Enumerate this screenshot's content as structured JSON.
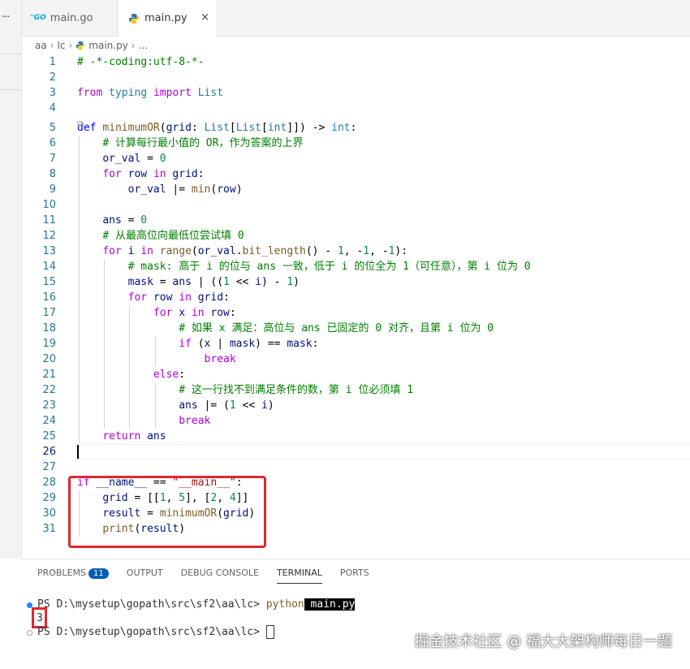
{
  "tabs": [
    {
      "label": "main.go",
      "icon": "go-file-icon"
    },
    {
      "label": "main.py",
      "icon": "python-file-icon",
      "close": "×"
    }
  ],
  "breadcrumb": [
    "aa",
    "lc",
    "main.py",
    "..."
  ],
  "code_lines": [
    {
      "n": "1",
      "tokens": [
        [
          "cm",
          "# -*-coding:utf-8-*-"
        ]
      ]
    },
    {
      "n": "2",
      "tokens": []
    },
    {
      "n": "3",
      "tokens": [
        [
          "kw2",
          "from"
        ],
        [
          "",
          " "
        ],
        [
          "ty",
          "typing"
        ],
        [
          "",
          " "
        ],
        [
          "kw2",
          "import"
        ],
        [
          "",
          " "
        ],
        [
          "ty",
          "List"
        ]
      ]
    },
    {
      "n": "4",
      "tokens": []
    },
    {
      "n": "5",
      "tokens": [
        [
          "kw",
          "def"
        ],
        [
          "",
          " "
        ],
        [
          "fn",
          "minimumOR"
        ],
        [
          "",
          "("
        ],
        [
          "var",
          "grid"
        ],
        [
          "",
          ": "
        ],
        [
          "ty",
          "List"
        ],
        [
          "",
          "["
        ],
        [
          "ty",
          "List"
        ],
        [
          "",
          "["
        ],
        [
          "ty",
          "int"
        ],
        [
          "",
          "]]) -> "
        ],
        [
          "ty",
          "int"
        ],
        [
          "",
          ":"
        ]
      ]
    },
    {
      "n": "6",
      "tokens": [
        [
          "",
          "    "
        ],
        [
          "cm",
          "# 计算每行最小值的 OR，作为答案的上界"
        ]
      ]
    },
    {
      "n": "7",
      "tokens": [
        [
          "",
          "    "
        ],
        [
          "var",
          "or_val"
        ],
        [
          "",
          " = "
        ],
        [
          "num",
          "0"
        ]
      ]
    },
    {
      "n": "8",
      "tokens": [
        [
          "",
          "    "
        ],
        [
          "kw2",
          "for"
        ],
        [
          "",
          " "
        ],
        [
          "var",
          "row"
        ],
        [
          "",
          " "
        ],
        [
          "kw2",
          "in"
        ],
        [
          "",
          " "
        ],
        [
          "var",
          "grid"
        ],
        [
          "",
          ":"
        ]
      ]
    },
    {
      "n": "9",
      "tokens": [
        [
          "",
          "        "
        ],
        [
          "var",
          "or_val"
        ],
        [
          "",
          " |= "
        ],
        [
          "fn",
          "min"
        ],
        [
          "",
          "("
        ],
        [
          "var",
          "row"
        ],
        [
          "",
          ")"
        ]
      ]
    },
    {
      "n": "10",
      "tokens": []
    },
    {
      "n": "11",
      "tokens": [
        [
          "",
          "    "
        ],
        [
          "var",
          "ans"
        ],
        [
          "",
          " = "
        ],
        [
          "num",
          "0"
        ]
      ]
    },
    {
      "n": "12",
      "tokens": [
        [
          "",
          "    "
        ],
        [
          "cm",
          "# 从最高位向最低位尝试填 0"
        ]
      ]
    },
    {
      "n": "13",
      "tokens": [
        [
          "",
          "    "
        ],
        [
          "kw2",
          "for"
        ],
        [
          "",
          " "
        ],
        [
          "var",
          "i"
        ],
        [
          "",
          " "
        ],
        [
          "kw2",
          "in"
        ],
        [
          "",
          " "
        ],
        [
          "fn",
          "range"
        ],
        [
          "",
          "("
        ],
        [
          "var",
          "or_val"
        ],
        [
          "",
          "."
        ],
        [
          "fn",
          "bit_length"
        ],
        [
          "",
          "() - "
        ],
        [
          "num",
          "1"
        ],
        [
          "",
          ", -"
        ],
        [
          "num",
          "1"
        ],
        [
          "",
          ", -"
        ],
        [
          "num",
          "1"
        ],
        [
          "",
          "):"
        ]
      ]
    },
    {
      "n": "14",
      "tokens": [
        [
          "",
          "        "
        ],
        [
          "cm",
          "# mask: 高于 i 的位与 ans 一致，低于 i 的位全为 1（可任意），第 i 位为 0"
        ]
      ]
    },
    {
      "n": "15",
      "tokens": [
        [
          "",
          "        "
        ],
        [
          "var",
          "mask"
        ],
        [
          "",
          " = "
        ],
        [
          "var",
          "ans"
        ],
        [
          "",
          " | (("
        ],
        [
          "num",
          "1"
        ],
        [
          "",
          " << "
        ],
        [
          "var",
          "i"
        ],
        [
          "",
          ") - "
        ],
        [
          "num",
          "1"
        ],
        [
          "",
          ")"
        ]
      ]
    },
    {
      "n": "16",
      "tokens": [
        [
          "",
          "        "
        ],
        [
          "kw2",
          "for"
        ],
        [
          "",
          " "
        ],
        [
          "var",
          "row"
        ],
        [
          "",
          " "
        ],
        [
          "kw2",
          "in"
        ],
        [
          "",
          " "
        ],
        [
          "var",
          "grid"
        ],
        [
          "",
          ":"
        ]
      ]
    },
    {
      "n": "17",
      "tokens": [
        [
          "",
          "            "
        ],
        [
          "kw2",
          "for"
        ],
        [
          "",
          " "
        ],
        [
          "var",
          "x"
        ],
        [
          "",
          " "
        ],
        [
          "kw2",
          "in"
        ],
        [
          "",
          " "
        ],
        [
          "var",
          "row"
        ],
        [
          "",
          ":"
        ]
      ]
    },
    {
      "n": "18",
      "tokens": [
        [
          "",
          "                "
        ],
        [
          "cm",
          "# 如果 x 满足：高位与 ans 已固定的 0 对齐，且第 i 位为 0"
        ]
      ]
    },
    {
      "n": "19",
      "tokens": [
        [
          "",
          "                "
        ],
        [
          "kw2",
          "if"
        ],
        [
          "",
          " ("
        ],
        [
          "var",
          "x"
        ],
        [
          "",
          " | "
        ],
        [
          "var",
          "mask"
        ],
        [
          "",
          ") == "
        ],
        [
          "var",
          "mask"
        ],
        [
          "",
          ":"
        ]
      ]
    },
    {
      "n": "20",
      "tokens": [
        [
          "",
          "                    "
        ],
        [
          "kw2",
          "break"
        ]
      ]
    },
    {
      "n": "21",
      "tokens": [
        [
          "",
          "            "
        ],
        [
          "kw2",
          "else"
        ],
        [
          "",
          ":"
        ]
      ]
    },
    {
      "n": "22",
      "tokens": [
        [
          "",
          "                "
        ],
        [
          "cm",
          "# 这一行找不到满足条件的数，第 i 位必须填 1"
        ]
      ]
    },
    {
      "n": "23",
      "tokens": [
        [
          "",
          "                "
        ],
        [
          "var",
          "ans"
        ],
        [
          "",
          " |= ("
        ],
        [
          "num",
          "1"
        ],
        [
          "",
          " << "
        ],
        [
          "var",
          "i"
        ],
        [
          "",
          ")"
        ]
      ]
    },
    {
      "n": "24",
      "tokens": [
        [
          "",
          "                "
        ],
        [
          "kw2",
          "break"
        ]
      ]
    },
    {
      "n": "25",
      "tokens": [
        [
          "",
          "    "
        ],
        [
          "kw2",
          "return"
        ],
        [
          "",
          " "
        ],
        [
          "var",
          "ans"
        ]
      ]
    },
    {
      "n": "26",
      "tokens": []
    },
    {
      "n": "27",
      "tokens": []
    },
    {
      "n": "28",
      "tokens": [
        [
          "kw2",
          "if"
        ],
        [
          "",
          " "
        ],
        [
          "var",
          "__name__"
        ],
        [
          "",
          " == "
        ],
        [
          "str",
          "\"__main__\""
        ],
        [
          "",
          ":"
        ]
      ]
    },
    {
      "n": "29",
      "tokens": [
        [
          "",
          "    "
        ],
        [
          "var",
          "grid"
        ],
        [
          "",
          " = [["
        ],
        [
          "num",
          "1"
        ],
        [
          "",
          ", "
        ],
        [
          "num",
          "5"
        ],
        [
          "",
          "], ["
        ],
        [
          "num",
          "2"
        ],
        [
          "",
          ", "
        ],
        [
          "num",
          "4"
        ],
        [
          "",
          "]]"
        ]
      ]
    },
    {
      "n": "30",
      "tokens": [
        [
          "",
          "    "
        ],
        [
          "var",
          "result"
        ],
        [
          "",
          " = "
        ],
        [
          "fn",
          "minimumOR"
        ],
        [
          "",
          "("
        ],
        [
          "var",
          "grid"
        ],
        [
          "",
          ")"
        ]
      ]
    },
    {
      "n": "31",
      "tokens": [
        [
          "",
          "    "
        ],
        [
          "fn",
          "print"
        ],
        [
          "",
          "("
        ],
        [
          "var",
          "result"
        ],
        [
          "",
          ")"
        ]
      ]
    }
  ],
  "panel": {
    "tabs": [
      "PROBLEMS",
      "OUTPUT",
      "DEBUG CONSOLE",
      "TERMINAL",
      "PORTS"
    ],
    "problems_count": "11",
    "active_tab": "TERMINAL"
  },
  "terminal": {
    "prompt": "PS D:\\mysetup\\gopath\\src\\sf2\\aa\\lc> ",
    "command": "python",
    "arg": " main.py",
    "output": "3"
  },
  "watermark": "掘金技术社区 @ 福大大架构师每日一题",
  "colors": {
    "accent": "#005fb8",
    "highlight_box": "#e0282e"
  }
}
